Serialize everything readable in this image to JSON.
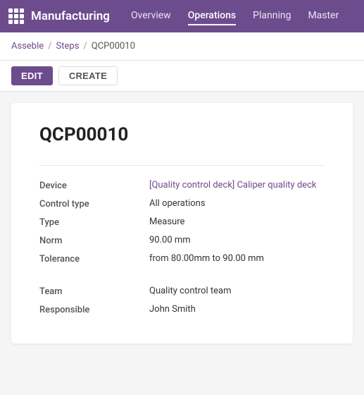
{
  "nav": {
    "logo": "Manufacturing",
    "links": [
      {
        "label": "Overview",
        "active": false
      },
      {
        "label": "Operations",
        "active": true
      },
      {
        "label": "Planning",
        "active": false
      },
      {
        "label": "Master",
        "active": false
      }
    ]
  },
  "breadcrumb": {
    "root": "Asseble",
    "sep1": "/",
    "parent": "Steps",
    "sep2": "/",
    "current": "QCP00010"
  },
  "actions": {
    "edit": "EDIT",
    "create": "CREATE"
  },
  "record": {
    "title": "QCP00010",
    "fields": {
      "device_label": "Device",
      "device_value": "[Quality control deck] Caliper quality deck",
      "control_type_label": "Control type",
      "control_type_value": "All operations",
      "type_label": "Type",
      "type_value": "Measure",
      "norm_label": "Norm",
      "norm_value": "90.00 mm",
      "tolerance_label": "Tolerance",
      "tolerance_value": "from 80.00mm to 90.00 mm",
      "team_label": "Team",
      "team_value": "Quality control team",
      "responsible_label": "Responsible",
      "responsible_value": "John Smith"
    }
  }
}
